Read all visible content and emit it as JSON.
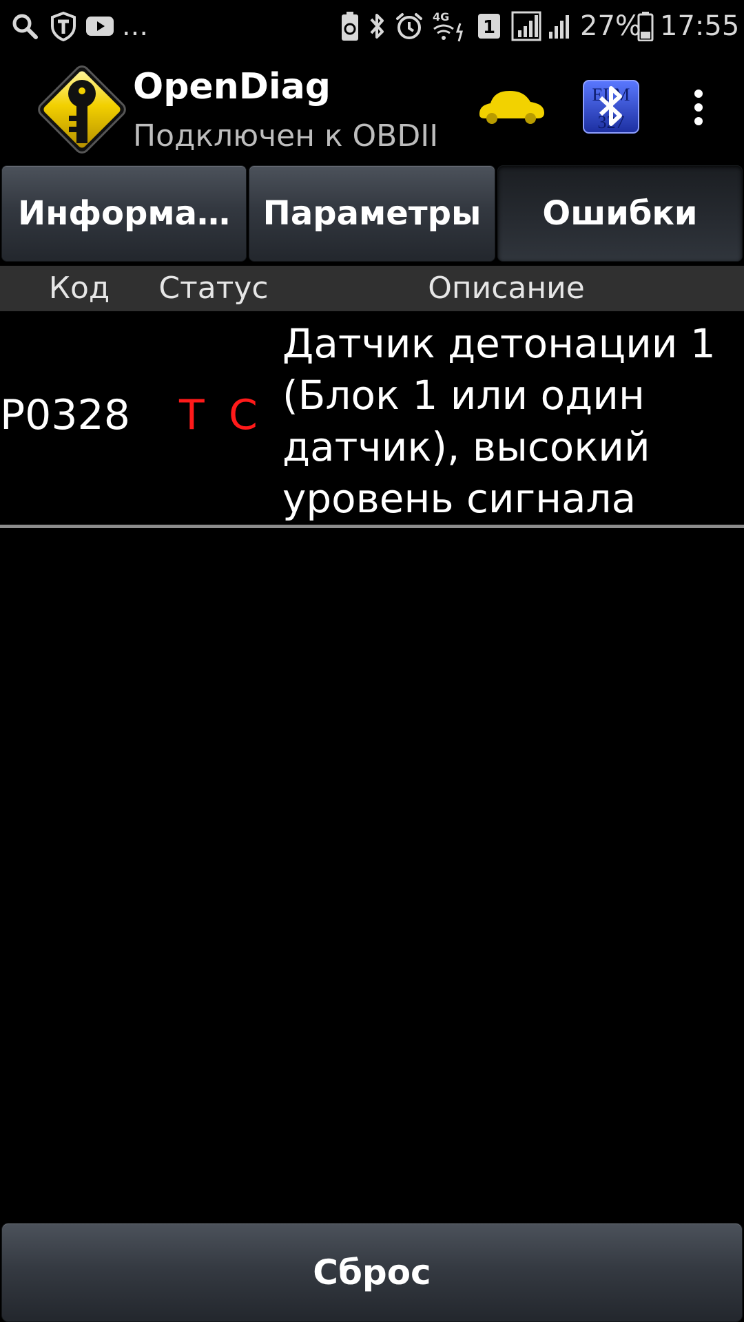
{
  "status_bar": {
    "more_notifications": "...",
    "network_type": "4G",
    "sim_slot": "1",
    "battery_percent": "27%",
    "time": "17:55"
  },
  "toolbar": {
    "title": "OpenDiag",
    "subtitle": "Подключен к OBDII",
    "adapter_icon_text_top": "ELM",
    "adapter_icon_text_bottom": "327"
  },
  "tabs": [
    {
      "label": "Информа…",
      "active": false
    },
    {
      "label": "Параметры",
      "active": false
    },
    {
      "label": "Ошибки",
      "active": true
    }
  ],
  "table": {
    "columns": {
      "code": "Код",
      "status": "Статус",
      "description": "Описание"
    },
    "rows": [
      {
        "code": "P0328",
        "status_flags": [
          "T",
          "C"
        ],
        "description": "Датчик детонации 1 (Блок 1 или один датчик), высокий уровень сигнала"
      }
    ]
  },
  "footer": {
    "reset_label": "Сброс"
  },
  "colors": {
    "status_flag": "#ff1a1a",
    "car_icon": "#f2d200",
    "adapter_icon": "#2f48c8"
  }
}
